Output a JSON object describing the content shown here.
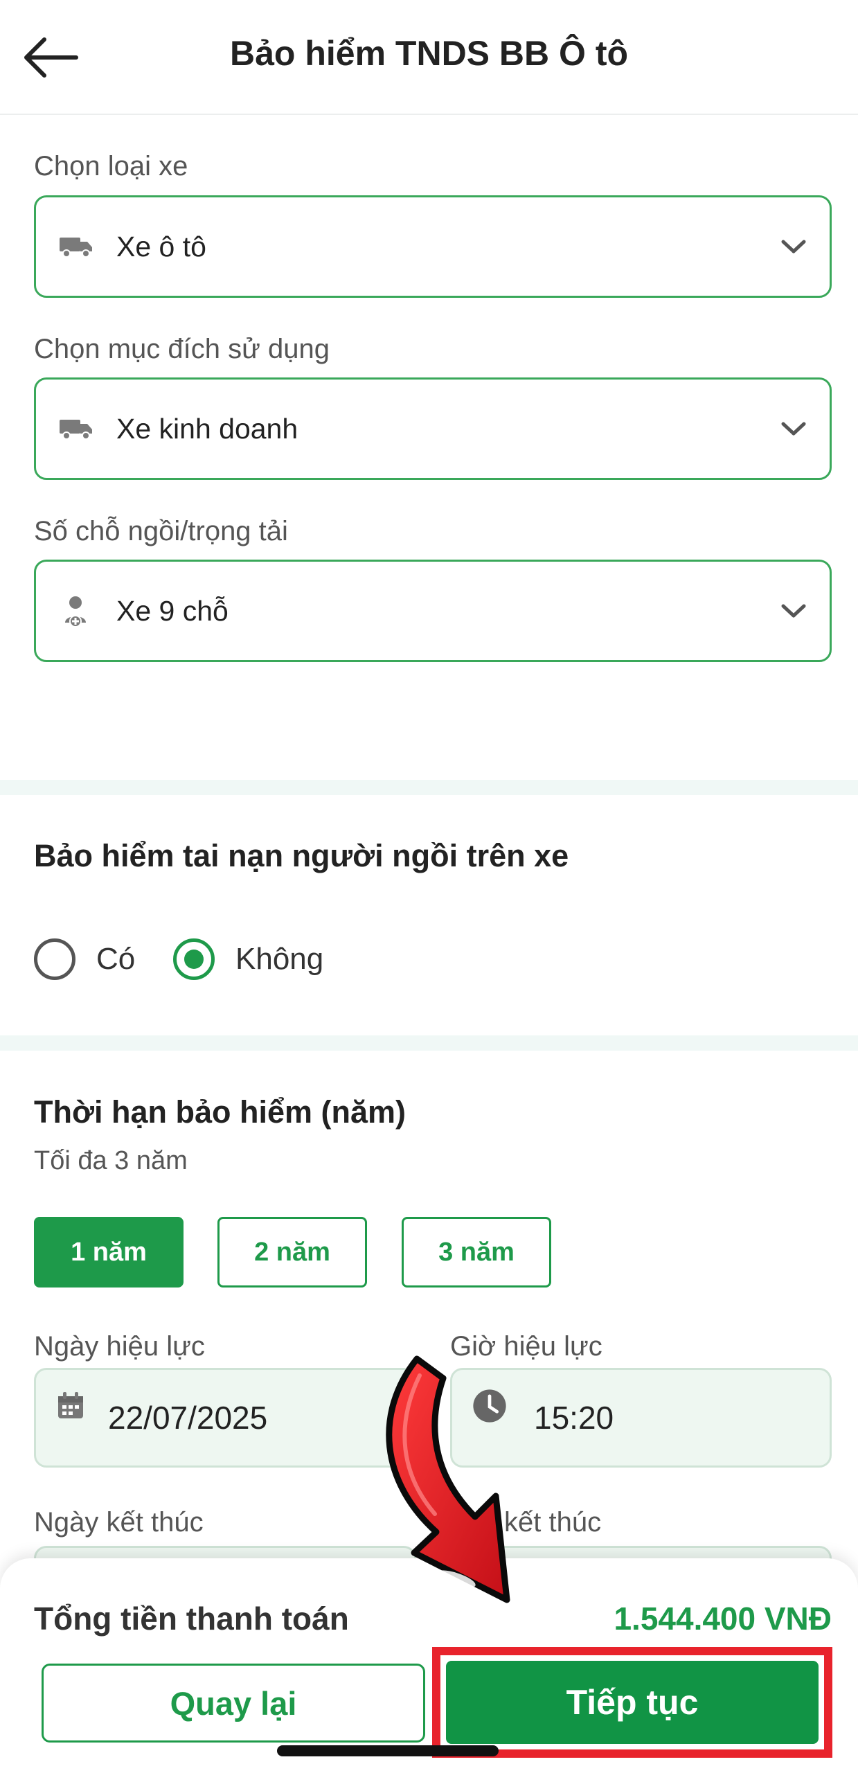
{
  "header": {
    "title": "Bảo hiểm TNDS BB Ô tô",
    "back_icon": "arrow-left-icon"
  },
  "form": {
    "vehicle_type": {
      "label": "Chọn loại xe",
      "value": "Xe ô tô",
      "icon": "truck-icon"
    },
    "usage_purpose": {
      "label": "Chọn mục đích sử dụng",
      "value": "Xe kinh doanh",
      "icon": "truck-icon"
    },
    "seats": {
      "label": "Số chỗ ngồi/trọng tải",
      "value": "Xe 9 chỗ",
      "icon": "person-add-icon"
    }
  },
  "accident_insurance": {
    "title": "Bảo hiểm tai nạn người ngồi trên xe",
    "options": [
      {
        "label": "Có",
        "selected": false
      },
      {
        "label": "Không",
        "selected": true
      }
    ]
  },
  "term": {
    "title": "Thời hạn bảo hiểm (năm)",
    "subtitle": "Tối đa 3 năm",
    "options": [
      {
        "label": "1 năm",
        "selected": true
      },
      {
        "label": "2 năm",
        "selected": false
      },
      {
        "label": "3 năm",
        "selected": false
      }
    ],
    "start_date": {
      "label": "Ngày hiệu lực",
      "value": "22/07/2025",
      "icon": "calendar-icon"
    },
    "start_time": {
      "label": "Giờ hiệu lực",
      "value": "15:20",
      "icon": "clock-icon"
    },
    "end_date": {
      "label": "Ngày kết thúc"
    },
    "end_time": {
      "label": "kết thúc"
    }
  },
  "footer": {
    "total_label": "Tổng tiền thanh toán",
    "total_value": "1.544.400 VNĐ",
    "back_button": "Quay lại",
    "next_button": "Tiếp tục"
  },
  "colors": {
    "primary": "#1e9a4a",
    "annotation": "#e8232c"
  }
}
